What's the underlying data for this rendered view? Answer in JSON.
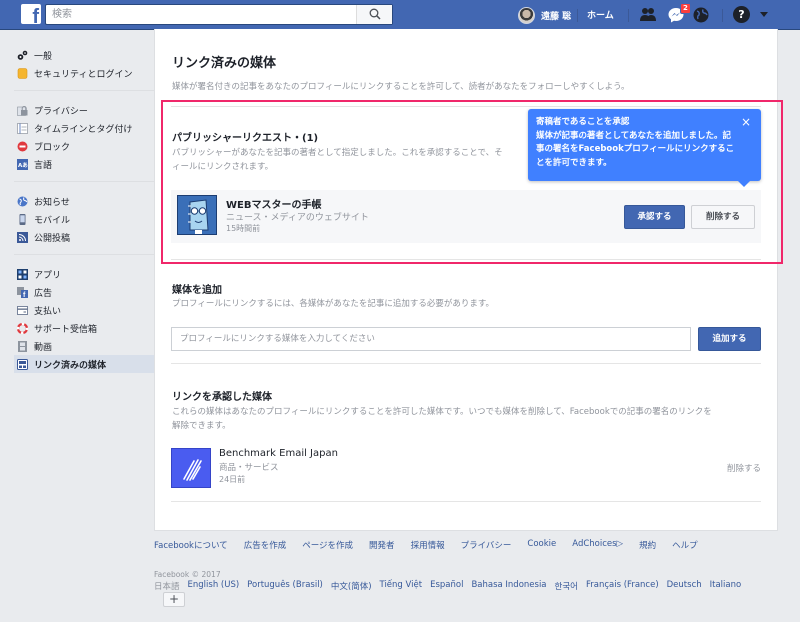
{
  "topbar": {
    "logo": "f",
    "search_placeholder": "検索",
    "user_name": "遠藤 聡",
    "home_label": "ホーム",
    "messages_badge": "2",
    "help_label": "?"
  },
  "sidebar": {
    "groups": [
      [
        {
          "icon": "gear-icon",
          "label": "一般"
        },
        {
          "icon": "shield-icon",
          "label": "セキュリティとログイン"
        }
      ],
      [
        {
          "icon": "lock-icon",
          "label": "プライバシー"
        },
        {
          "icon": "timeline-icon",
          "label": "タイムラインとタグ付け"
        },
        {
          "icon": "block-icon",
          "label": "ブロック"
        },
        {
          "icon": "language-icon",
          "label": "言語"
        }
      ],
      [
        {
          "icon": "globe-icon",
          "label": "お知らせ"
        },
        {
          "icon": "mobile-icon",
          "label": "モバイル"
        },
        {
          "icon": "rss-icon",
          "label": "公開投稿"
        }
      ],
      [
        {
          "icon": "apps-icon",
          "label": "アプリ"
        },
        {
          "icon": "ads-icon",
          "label": "広告"
        },
        {
          "icon": "card-icon",
          "label": "支払い"
        },
        {
          "icon": "lifebuoy-icon",
          "label": "サポート受信箱"
        },
        {
          "icon": "film-icon",
          "label": "動画"
        },
        {
          "icon": "media-icon",
          "label": "リンク済みの媒体",
          "active": true
        }
      ]
    ]
  },
  "main": {
    "title": "リンク済みの媒体",
    "description": "媒体が署名付きの記事をあなたのプロフィールにリンクすることを許可して、読者があなたをフォローしやすくしよう。",
    "publisher_requests": {
      "title": "パブリッシャーリクエスト・(1)",
      "description_line1": "パブリッシャーがあなたを記事の著者として指定しました。これを承認することで、そ",
      "description_line2": "ィールにリンクされます。",
      "items": [
        {
          "name": "WEBマスターの手帳",
          "category": "ニュース・メディアのウェブサイト",
          "time": "15時間前",
          "approve_label": "承認する",
          "delete_label": "削除する"
        }
      ]
    },
    "tooltip": {
      "title": "寄稿者であることを承認",
      "body": "媒体が記事の著者としてあなたを追加しました。記事の署名をFacebookプロフィールにリンクすることを許可できます。",
      "close": "×"
    },
    "add_media": {
      "title": "媒体を追加",
      "description": "プロフィールにリンクするには、各媒体があなたを記事に追加する必要があります。",
      "input_placeholder": "プロフィールにリンクする媒体を入力してください",
      "input_value": "",
      "button_label": "追加する"
    },
    "approved_media": {
      "title": "リンクを承認した媒体",
      "description_line1": "これらの媒体はあなたのプロフィールにリンクすることを許可した媒体です。いつでも媒体を削除して、Facebookでの記事の署名のリンクを",
      "description_line2": "解除できます。",
      "items": [
        {
          "name": "Benchmark Email Japan",
          "category": "商品・サービス",
          "time": "24日前",
          "remove_label": "削除する"
        }
      ]
    }
  },
  "footer": {
    "links": [
      "Facebookについて",
      "広告を作成",
      "ページを作成",
      "開発者",
      "採用情報",
      "プライバシー",
      "Cookie",
      "AdChoices▷",
      "規約",
      "ヘルプ"
    ],
    "copyright": "Facebook © 2017",
    "languages": [
      "日本語",
      "English (US)",
      "Português (Brasil)",
      "中文(简体)",
      "Tiếng Việt",
      "Español",
      "Bahasa Indonesia",
      "한국어",
      "Français (France)",
      "Deutsch",
      "Italiano"
    ],
    "more_languages": "+"
  },
  "colors": {
    "brand": "#4267b2",
    "highlight": "#f0276a",
    "tooltip": "#4080ff"
  }
}
